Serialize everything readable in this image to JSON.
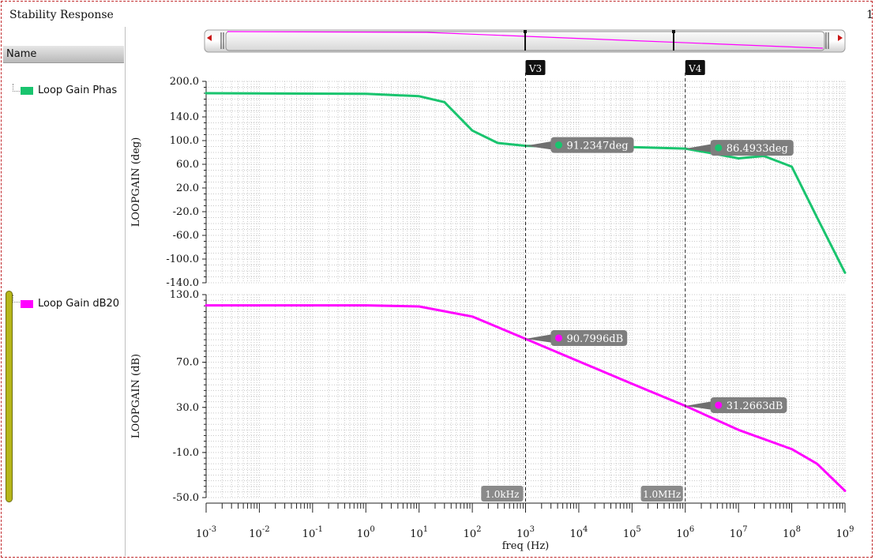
{
  "window": {
    "title": "Stability Response",
    "corner_text": "1"
  },
  "legend": {
    "header": "Name",
    "items": [
      {
        "label": "Loop Gain Phas",
        "color": "#19c46e"
      },
      {
        "label": "Loop Gain dB20",
        "color": "#ff00ff"
      }
    ]
  },
  "markers": [
    {
      "label": "V3",
      "x_label": "1.0kHz",
      "freq": 1000
    },
    {
      "label": "V4",
      "x_label": "1.0MHz",
      "freq": 1000000
    }
  ],
  "annotations": [
    {
      "text": "91.2347deg",
      "plot": "phase",
      "freq": 1000,
      "value": 91.2347
    },
    {
      "text": "86.4933deg",
      "plot": "phase",
      "freq": 1000000,
      "value": 86.4933
    },
    {
      "text": "90.7996dB",
      "plot": "gain",
      "freq": 1000,
      "value": 90.7996
    },
    {
      "text": "31.2663dB",
      "plot": "gain",
      "freq": 1000000,
      "value": 31.2663
    }
  ],
  "chart_data": [
    {
      "type": "line",
      "name": "phase",
      "ylabel": "LOOPGAIN (deg)",
      "xscale": "log",
      "ylim": [
        -140,
        200
      ],
      "yticks": [
        "200.0",
        "140.0",
        "100.0",
        "60.0",
        "20.0",
        "-20.0",
        "-60.0",
        "-100.0",
        "-140.0"
      ],
      "color": "#19c46e",
      "series": [
        {
          "name": "Loop Gain Phas",
          "x": [
            0.001,
            1,
            10,
            30,
            100,
            300,
            1000,
            10000,
            100000,
            1000000,
            3000000,
            10000000,
            30000000,
            100000000,
            300000000,
            1000000000
          ],
          "y": [
            180,
            179,
            175,
            165,
            117,
            96,
            91.2,
            89,
            89,
            86.5,
            79,
            70,
            74,
            56,
            -30,
            -123
          ]
        }
      ]
    },
    {
      "type": "line",
      "name": "gain",
      "ylabel": "LOOPGAIN (dB)",
      "xlabel": "freq (Hz)",
      "xscale": "log",
      "ylim": [
        -50,
        130
      ],
      "yticks": [
        "130.0",
        "70.0",
        "30.0",
        "-10.0",
        "-50.0"
      ],
      "xticks": [
        -3,
        -2,
        -1,
        0,
        1,
        2,
        3,
        4,
        5,
        6,
        7,
        8,
        9
      ],
      "color": "#ff00ff",
      "series": [
        {
          "name": "Loop Gain dB20",
          "x": [
            0.001,
            1,
            10,
            100,
            1000,
            10000,
            100000,
            1000000,
            10000000,
            100000000,
            300000000,
            1000000000
          ],
          "y": [
            120.5,
            120.5,
            119.5,
            110.5,
            90.8,
            70.8,
            50.9,
            31.3,
            10,
            -7,
            -20,
            -44
          ]
        }
      ]
    }
  ]
}
